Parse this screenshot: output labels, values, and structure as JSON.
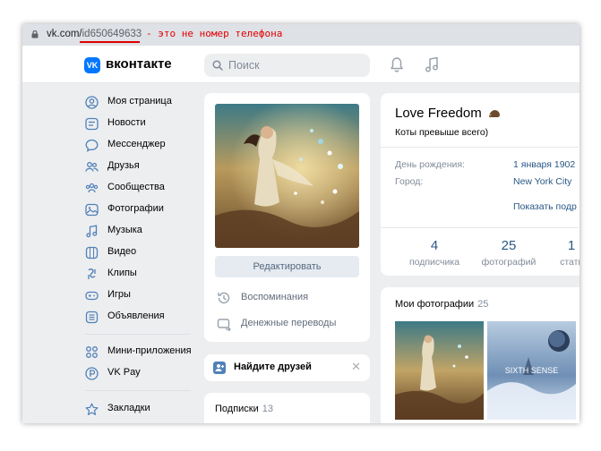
{
  "address_bar": {
    "url_host": "vk.com/",
    "url_path": "id650649633",
    "annotation": "- это не номер телефона"
  },
  "header": {
    "logo_mark": "VK",
    "logo_text": "вконтакте",
    "search_placeholder": "Поиск",
    "icons": [
      "bell-icon",
      "music-icon"
    ]
  },
  "sidebar": {
    "items": [
      {
        "label": "Моя страница",
        "icon": "user-circle-icon"
      },
      {
        "label": "Новости",
        "icon": "news-icon"
      },
      {
        "label": "Мессенджер",
        "icon": "chat-bubble-icon"
      },
      {
        "label": "Друзья",
        "icon": "friends-icon"
      },
      {
        "label": "Сообщества",
        "icon": "communities-icon"
      },
      {
        "label": "Фотографии",
        "icon": "photo-icon"
      },
      {
        "label": "Музыка",
        "icon": "music-icon"
      },
      {
        "label": "Видео",
        "icon": "video-icon"
      },
      {
        "label": "Клипы",
        "icon": "clips-icon"
      },
      {
        "label": "Игры",
        "icon": "gamepad-icon"
      },
      {
        "label": "Объявления",
        "icon": "classifieds-icon"
      },
      {
        "label": "Мини-приложения",
        "icon": "apps-icon"
      },
      {
        "label": "VK Pay",
        "icon": "vkpay-icon"
      },
      {
        "label": "Закладки",
        "icon": "star-icon"
      }
    ]
  },
  "left_column": {
    "edit_button": "Редактировать",
    "memories": "Воспоминания",
    "money_transfers": "Денежные переводы",
    "find_friends": "Найдите друзей",
    "close_symbol": "✕",
    "subscriptions_title": "Подписки",
    "subscriptions_count": "13"
  },
  "profile": {
    "name": "Love Freedom",
    "status": "Коты превыше всего)",
    "birthday_label": "День рождения:",
    "birthday_value": "1 января 1902",
    "city_label": "Город:",
    "city_value": "New York City",
    "show_more": "Показать подр",
    "stats": [
      {
        "value": "4",
        "caption": "подписчика"
      },
      {
        "value": "25",
        "caption": "фотографий"
      },
      {
        "value": "1",
        "caption": "стать"
      }
    ]
  },
  "photos": {
    "title": "Мои фотографии",
    "count": "25",
    "thumb2_text": "SIXTH SENSE"
  },
  "colors": {
    "accent": "#0077ff",
    "link": "#2a5885",
    "annotation": "#e00000",
    "page_bg": "#edeef0"
  }
}
